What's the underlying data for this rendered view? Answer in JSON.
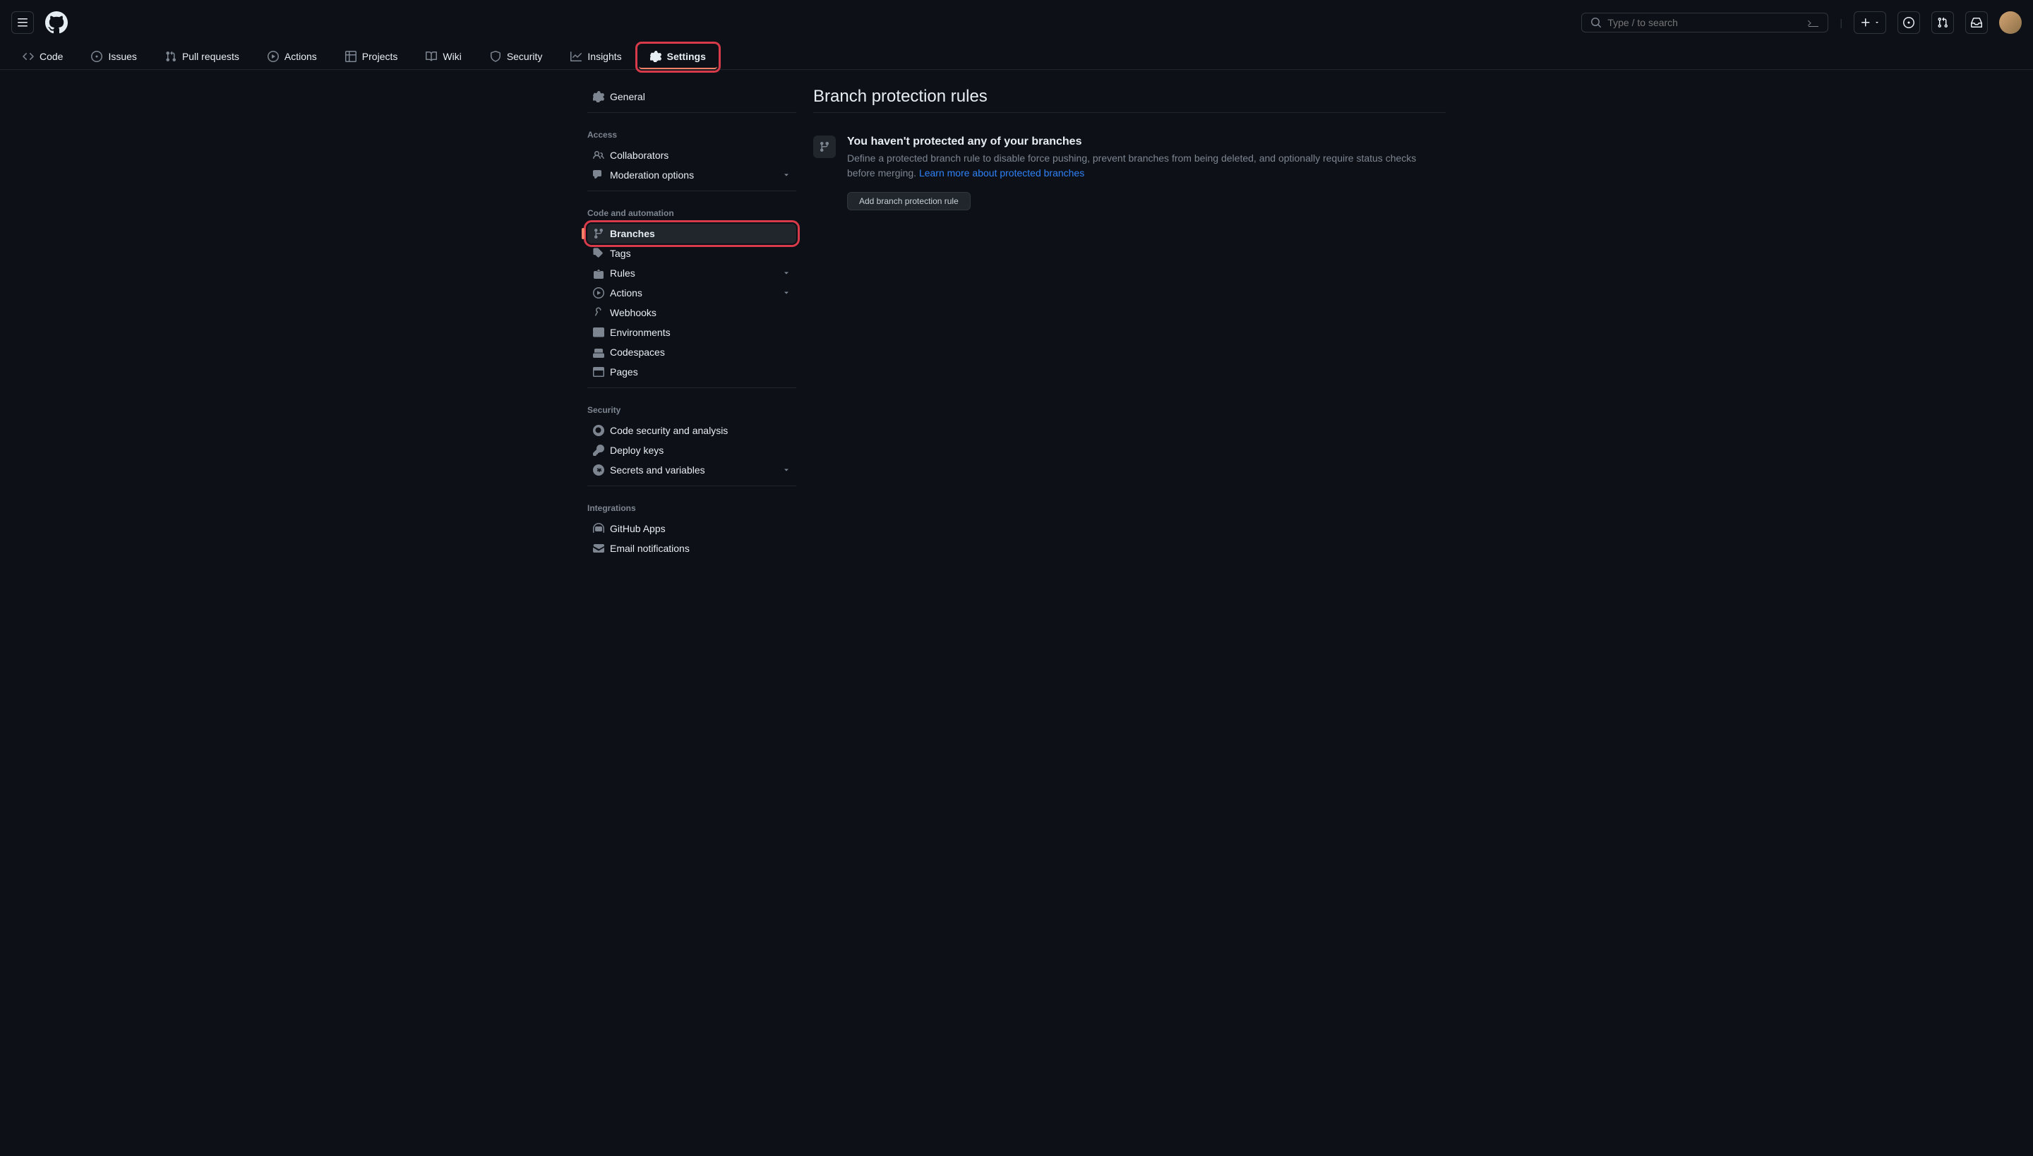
{
  "search": {
    "placeholder": "Type / to search"
  },
  "nav": {
    "code": "Code",
    "issues": "Issues",
    "pull_requests": "Pull requests",
    "actions": "Actions",
    "projects": "Projects",
    "wiki": "Wiki",
    "security": "Security",
    "insights": "Insights",
    "settings": "Settings"
  },
  "sidebar": {
    "general": "General",
    "sections": {
      "access": "Access",
      "code_automation": "Code and automation",
      "security": "Security",
      "integrations": "Integrations"
    },
    "access": {
      "collaborators": "Collaborators",
      "moderation": "Moderation options"
    },
    "code_automation": {
      "branches": "Branches",
      "tags": "Tags",
      "rules": "Rules",
      "actions": "Actions",
      "webhooks": "Webhooks",
      "environments": "Environments",
      "codespaces": "Codespaces",
      "pages": "Pages"
    },
    "security": {
      "code_security": "Code security and analysis",
      "deploy_keys": "Deploy keys",
      "secrets": "Secrets and variables"
    },
    "integrations": {
      "github_apps": "GitHub Apps",
      "email_notifications": "Email notifications"
    }
  },
  "content": {
    "title": "Branch protection rules",
    "info_title": "You haven't protected any of your branches",
    "info_desc": "Define a protected branch rule to disable force pushing, prevent branches from being deleted, and optionally require status checks before merging. ",
    "info_link": "Learn more about protected branches",
    "button": "Add branch protection rule"
  }
}
